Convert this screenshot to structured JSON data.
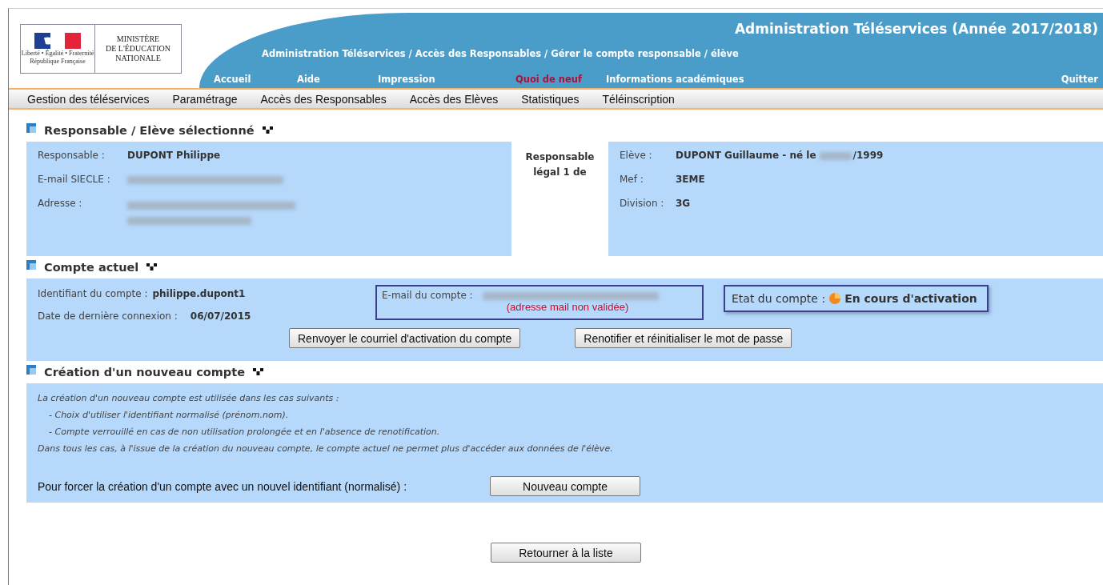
{
  "header": {
    "logo": {
      "motto": "Liberté • Égalité • Fraternité",
      "republic": "République Française",
      "ministry_lines": [
        "MINISTÈRE",
        "DE L'ÉDUCATION",
        "NATIONALE"
      ]
    },
    "app_title": "Administration Téléservices (Année 2017/2018)",
    "breadcrumb": "Administration Téléservices / Accès des Responsables / Gérer le compte responsable / élève",
    "top_links": [
      {
        "label": "Accueil",
        "highlighted": false
      },
      {
        "label": "Aide",
        "highlighted": false
      },
      {
        "label": "Impression",
        "highlighted": false
      },
      {
        "label": "Quoi de neuf",
        "highlighted": true
      },
      {
        "label": "Informations académiques",
        "highlighted": false
      }
    ],
    "quit_link": "Quitter"
  },
  "menu": [
    "Gestion des téléservices",
    "Paramétrage",
    "Accès des Responsables",
    "Accès des Elèves",
    "Statistiques",
    "Téléinscription"
  ],
  "selected_section": {
    "title": "Responsable / Elève sélectionné",
    "responsible_rows": [
      {
        "label": "Responsable :",
        "kind": "text",
        "value": "DUPONT Philippe"
      },
      {
        "label": "E-mail SIECLE :",
        "kind": "redacted"
      },
      {
        "label": "Adresse :",
        "kind": "redacted_multiline"
      }
    ],
    "relation": "Responsable légal 1 de",
    "student_rows": [
      {
        "label": "Elève :",
        "kind": "redacted_date",
        "value_before": "DUPONT Guillaume - né le",
        "value_after": "/1999"
      },
      {
        "label": "Mef :",
        "kind": "text",
        "value": "3EME"
      },
      {
        "label": "Division :",
        "kind": "text",
        "value": "3G"
      }
    ]
  },
  "account_section": {
    "title": "Compte actuel",
    "rows": [
      {
        "label": "Identifiant du compte :",
        "value": "philippe.dupont1"
      },
      {
        "label": "Date de dernière connexion :",
        "value": "06/07/2015"
      }
    ],
    "email": {
      "label": "E-mail du compte :",
      "note": "(adresse mail non validée)"
    },
    "state": {
      "label": "Etat du compte :",
      "value": "En cours d'activation"
    },
    "buttons": [
      "Renvoyer le courriel d'activation du compte",
      "Renotifier et réinitialiser le mot de passe"
    ]
  },
  "new_account_section": {
    "title": "Création d'un nouveau compte",
    "info_lines": [
      {
        "text": "La création d'un nouveau compte est utilisée dans les cas suivants :",
        "indented": false
      },
      {
        "text": "- Choix d'utiliser l'identifiant normalisé (prénom.nom).",
        "indented": true
      },
      {
        "text": "- Compte verrouillé en cas de non utilisation prolongée et en l'absence de renotification.",
        "indented": true
      },
      {
        "text": "Dans tous les cas, à l'issue de la création du nouveau compte, le compte actuel ne permet plus d'accéder aux données de l'élève.",
        "indented": false
      }
    ],
    "prompt": "Pour forcer la création d'un compte avec un nouvel identifiant (normalisé) :",
    "button": "Nouveau compte"
  },
  "back_button": "Retourner à la liste"
}
